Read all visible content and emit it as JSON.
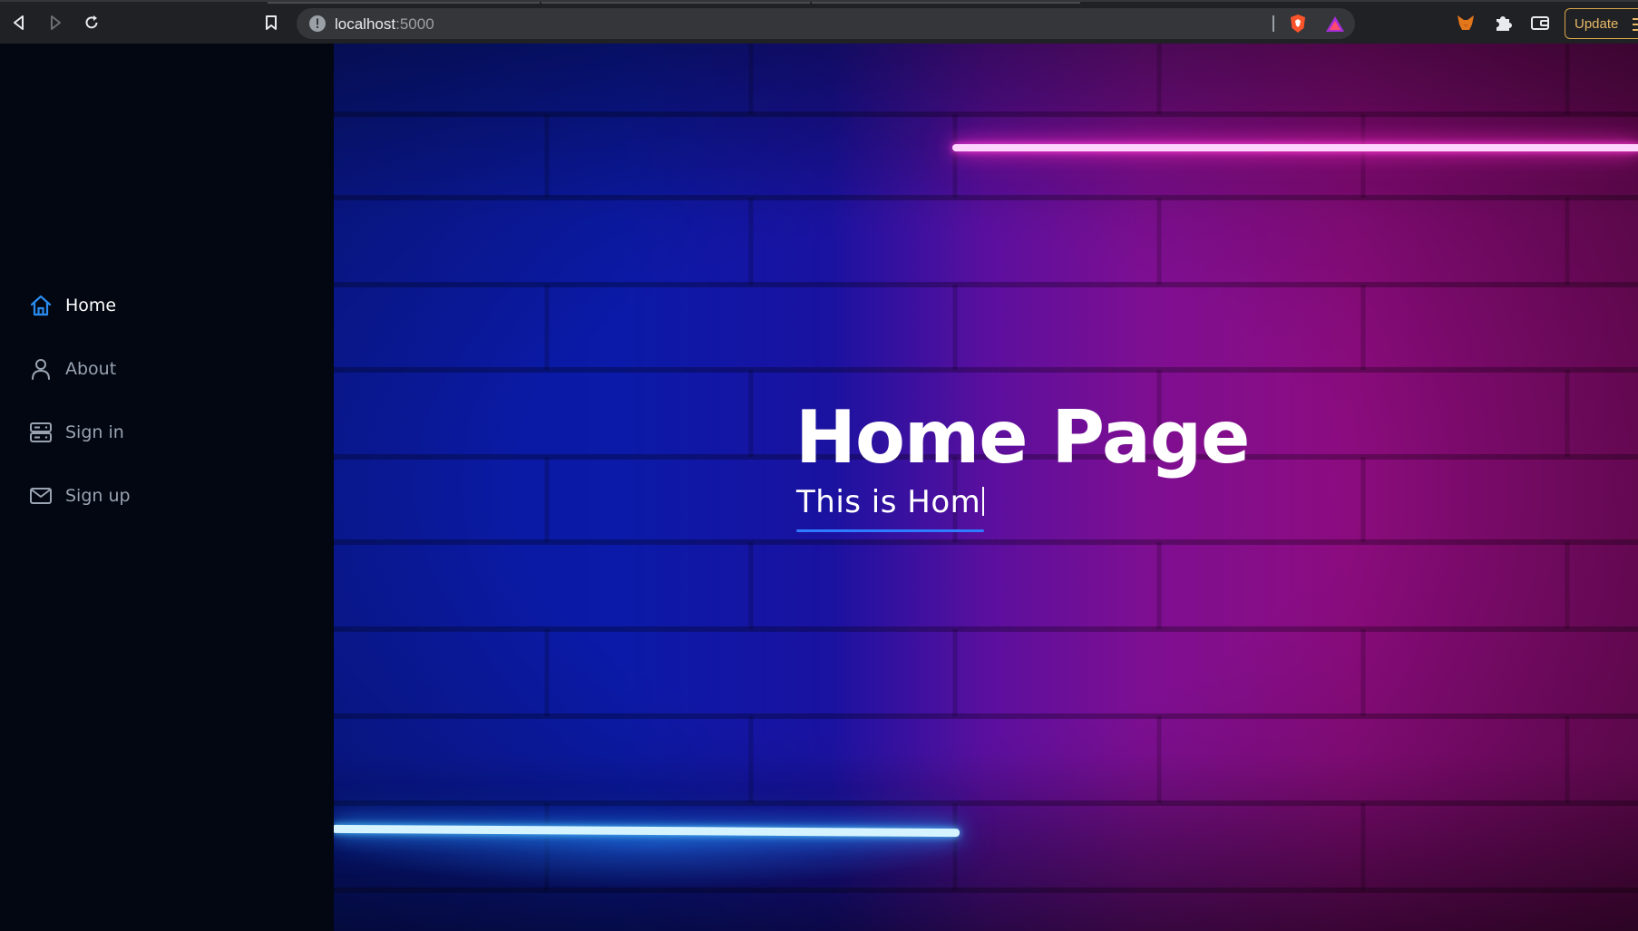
{
  "browser": {
    "url_host": "localhost",
    "url_port": ":5000",
    "update_label": "Update"
  },
  "sidebar": {
    "items": [
      {
        "label": "Home",
        "icon": "home-icon",
        "active": true
      },
      {
        "label": "About",
        "icon": "user-icon",
        "active": false
      },
      {
        "label": "Sign in",
        "icon": "server-icon",
        "active": false
      },
      {
        "label": "Sign up",
        "icon": "mail-icon",
        "active": false
      }
    ]
  },
  "hero": {
    "title": "Home Page",
    "subtitle": "This is Hom"
  },
  "colors": {
    "accent": "#2f7bff",
    "sidebar_bg": "#020711",
    "active_icon": "#2a8cf0",
    "inactive_icon": "#9aa3b2"
  }
}
